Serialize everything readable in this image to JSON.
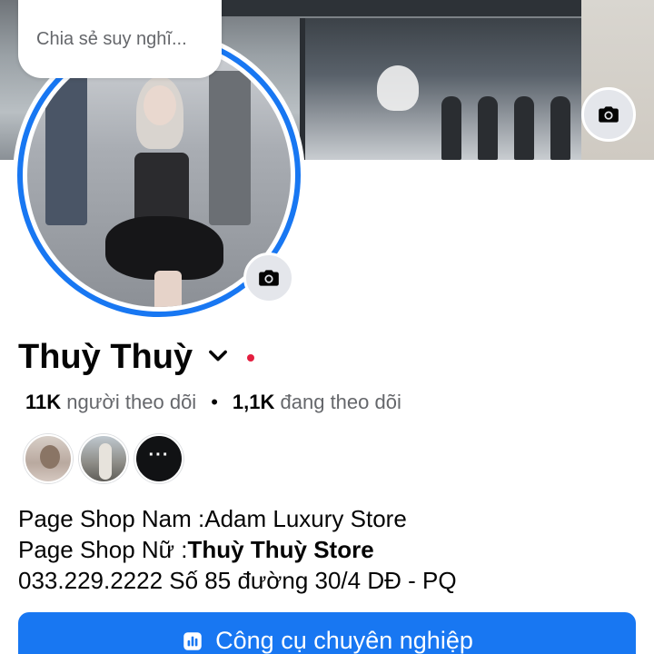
{
  "composer": {
    "thought_placeholder": "Chia sẻ suy nghĩ..."
  },
  "profile": {
    "name": "Thuỳ Thuỳ",
    "followers_count": "11K",
    "followers_label": "người theo dõi",
    "separator": "•",
    "following_count": "1,1K",
    "following_label": "đang theo dõi",
    "more_friends_label": "···"
  },
  "bio": {
    "line1": "Page Shop Nam :Adam Luxury Store",
    "line2_prefix": "Page Shop Nữ :",
    "line2_bold": "Thuỳ Thuỳ Store",
    "line3": "033.229.2222  Số 85 đường 30/4 DĐ - PQ"
  },
  "actions": {
    "professional_tools_label": "Công cụ chuyên nghiệp"
  },
  "icons": {
    "cover_camera": "camera-icon",
    "avatar_camera": "camera-icon",
    "name_menu": "chevron-down-icon",
    "pro_tools": "bar-chart-icon"
  },
  "colors": {
    "accent": "#1877f2",
    "status_dot": "#e41e3f",
    "secondary_text": "#65676b"
  }
}
